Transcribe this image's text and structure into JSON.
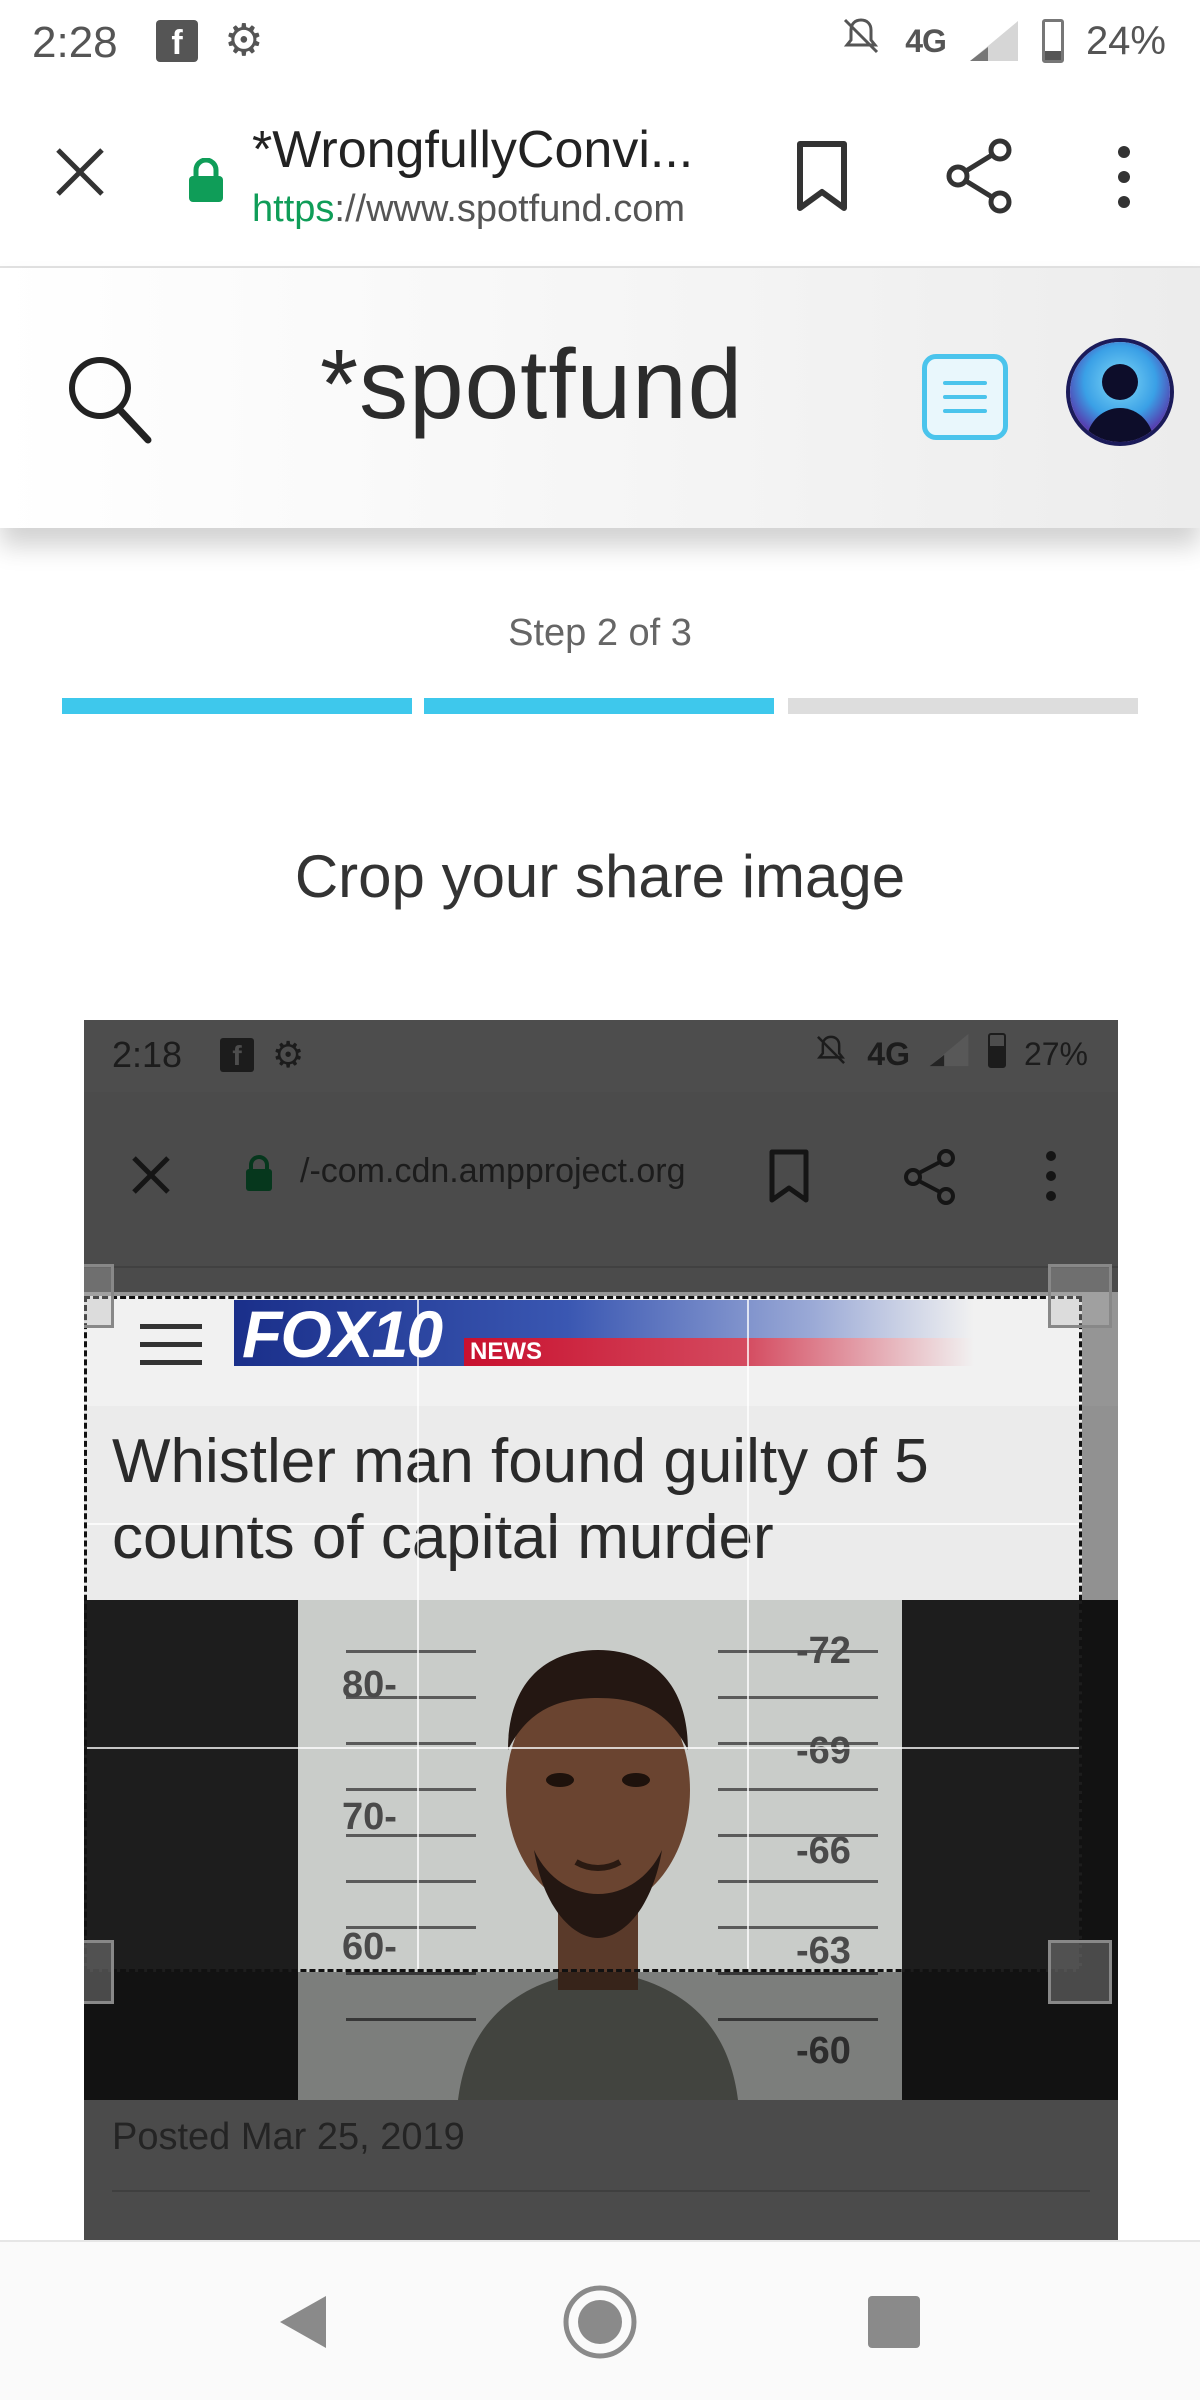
{
  "status_bar": {
    "time": "2:28",
    "facebook_glyph": "f",
    "network": "4G",
    "battery": "24%"
  },
  "browser": {
    "title": "*WrongfullyConvi...",
    "url_scheme": "https",
    "url_rest": "://www.spotfund.com"
  },
  "site": {
    "logo": "*spotfund"
  },
  "wizard": {
    "step_label": "Step 2 of 3",
    "steps_total": 3,
    "steps_completed": 2,
    "active_color": "#3ec8ec",
    "inactive_color": "#dddddd",
    "heading": "Crop your share image"
  },
  "embedded": {
    "time": "2:18",
    "facebook_glyph": "f",
    "network": "4G",
    "battery": "27%",
    "url": "/-com.cdn.ampproject.org",
    "brand": "FOX10",
    "brand_tag": "NEWS",
    "headline": "Whistler man found guilty of 5 counts of capital murder",
    "ruler_left": [
      "80-",
      "70-",
      "60-"
    ],
    "ruler_right": [
      "-72",
      "-69",
      "-66",
      "-63",
      "-60"
    ],
    "posted": "Posted Mar 25, 2019"
  }
}
